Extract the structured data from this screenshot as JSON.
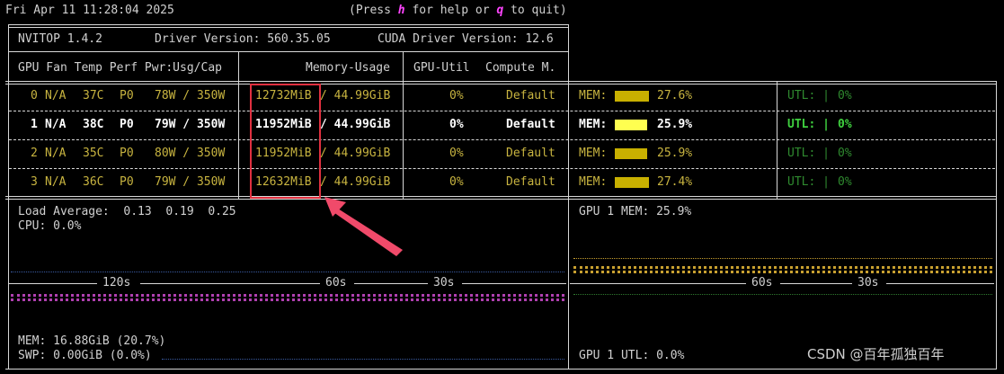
{
  "header": {
    "datetime": "Fri Apr 11 11:28:04 2025",
    "help_pre": "(Press ",
    "help_key": "h",
    "help_mid": " for help or ",
    "quit_key": "q",
    "help_post": " to quit)"
  },
  "info": {
    "app": "NVITOP 1.4.2",
    "driver": "Driver Version: 560.35.05",
    "cuda": "CUDA Driver Version: 12.6"
  },
  "columns": {
    "left": "GPU Fan Temp Perf Pwr:Usg/Cap",
    "memory": "Memory-Usage",
    "util": "GPU-Util",
    "compute": "Compute M."
  },
  "gpus": [
    {
      "idx": "0",
      "fan": "N/A",
      "temp": "37C",
      "perf": "P0",
      "pwr": "78W / 350W",
      "mem_used": "12732MiB",
      "mem_total": "/ 44.99GiB",
      "util": "0%",
      "compute": "Default",
      "mem_label": "MEM:",
      "mem_pct": "27.6%",
      "mem_frac": 0.276,
      "utl_label": "UTL: |",
      "utl_pct": "0%"
    },
    {
      "idx": "1",
      "fan": "N/A",
      "temp": "38C",
      "perf": "P0",
      "pwr": "79W / 350W",
      "mem_used": "11952MiB",
      "mem_total": "/ 44.99GiB",
      "util": "0%",
      "compute": "Default",
      "mem_label": "MEM:",
      "mem_pct": "25.9%",
      "mem_frac": 0.259,
      "utl_label": "UTL: |",
      "utl_pct": "0%"
    },
    {
      "idx": "2",
      "fan": "N/A",
      "temp": "35C",
      "perf": "P0",
      "pwr": "80W / 350W",
      "mem_used": "11952MiB",
      "mem_total": "/ 44.99GiB",
      "util": "0%",
      "compute": "Default",
      "mem_label": "MEM:",
      "mem_pct": "25.9%",
      "mem_frac": 0.259,
      "utl_label": "UTL: |",
      "utl_pct": "0%"
    },
    {
      "idx": "3",
      "fan": "N/A",
      "temp": "36C",
      "perf": "P0",
      "pwr": "79W / 350W",
      "mem_used": "12632MiB",
      "mem_total": "/ 44.99GiB",
      "util": "0%",
      "compute": "Default",
      "mem_label": "MEM:",
      "mem_pct": "27.4%",
      "mem_frac": 0.274,
      "utl_label": "UTL: |",
      "utl_pct": "0%"
    }
  ],
  "host": {
    "load_label": "Load Average:",
    "load_values": "0.13  0.19  0.25",
    "cpu": "CPU: 0.0%",
    "mem": "MEM: 16.88GiB (20.7%)",
    "swp": "SWP: 0.00GiB (0.0%)",
    "ticks": [
      "120s",
      "60s",
      "30s"
    ]
  },
  "gpu_panel": {
    "mem": "GPU 1 MEM: 25.9%",
    "utl": "GPU 1 UTL: 0.0%",
    "ticks": [
      "60s",
      "30s"
    ]
  },
  "watermark": "CSDN @百年孤独百年",
  "colors": {
    "background": "#000000",
    "text": "#d0d0d0",
    "dim_yellow": "#c8b440",
    "bar_yellow": "#c8b000",
    "bright_bar": "#ffff50",
    "green_dim": "#2f8a2f",
    "green_bright": "#3fd03f",
    "highlight_box": "#e03040",
    "key_magenta": "#ff44ff"
  }
}
